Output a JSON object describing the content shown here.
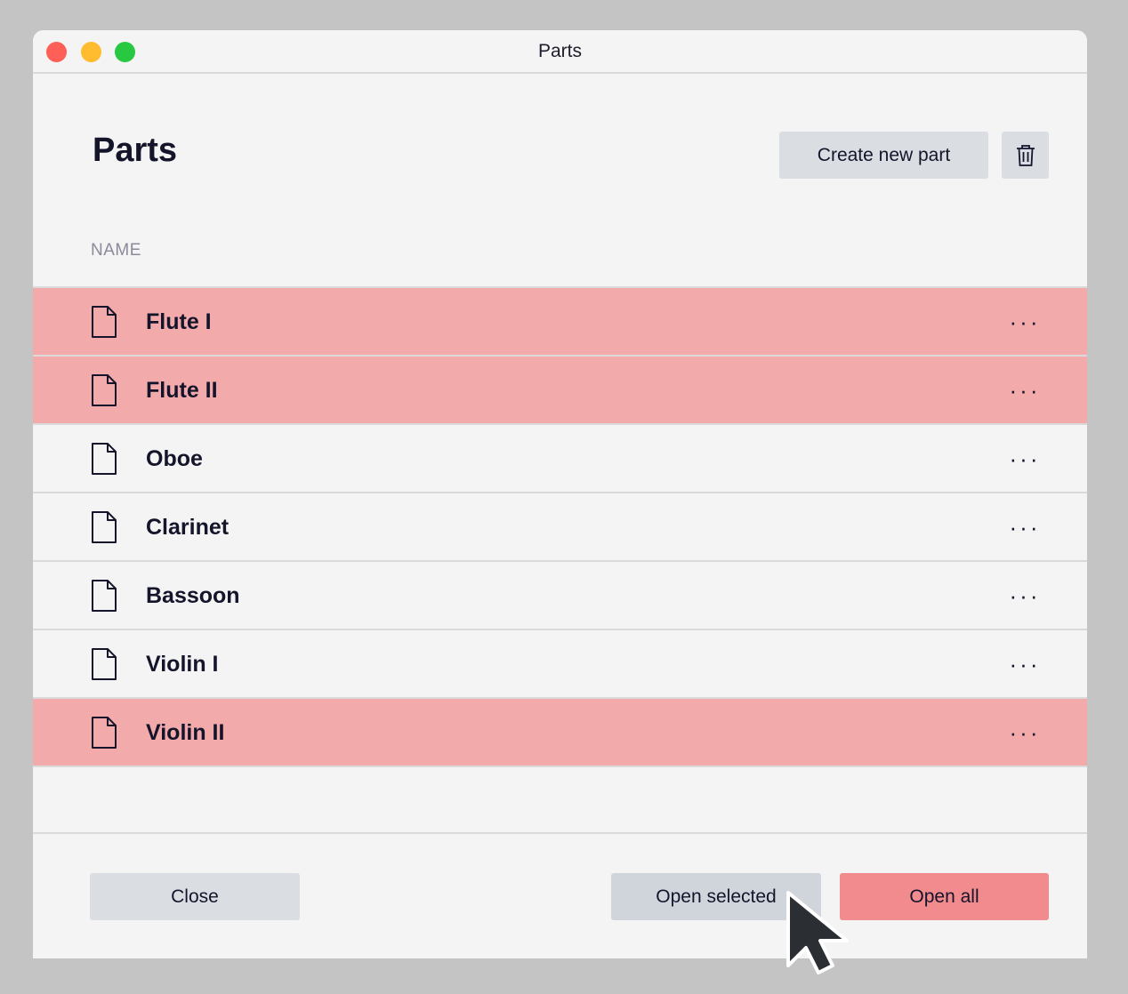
{
  "window": {
    "title": "Parts"
  },
  "header": {
    "title": "Parts",
    "create_button_label": "Create new part",
    "delete_icon": "trash-icon"
  },
  "table": {
    "column_header": "NAME",
    "rows": [
      {
        "label": "Flute I",
        "selected": true,
        "icon": "file-icon",
        "menu": "···"
      },
      {
        "label": "Flute II",
        "selected": true,
        "icon": "file-icon",
        "menu": "···"
      },
      {
        "label": "Oboe",
        "selected": false,
        "icon": "file-icon",
        "menu": "···"
      },
      {
        "label": "Clarinet",
        "selected": false,
        "icon": "file-icon",
        "menu": "···"
      },
      {
        "label": "Bassoon",
        "selected": false,
        "icon": "file-icon",
        "menu": "···"
      },
      {
        "label": "Violin I",
        "selected": false,
        "icon": "file-icon",
        "menu": "···"
      },
      {
        "label": "Violin II",
        "selected": true,
        "icon": "file-icon",
        "menu": "···"
      }
    ]
  },
  "footer": {
    "close_label": "Close",
    "open_selected_label": "Open selected",
    "open_all_label": "Open all"
  },
  "colors": {
    "selected_row": "#f2aaab",
    "primary_button": "#f28b8e",
    "secondary_button": "#dadee3",
    "text": "#14142b"
  }
}
